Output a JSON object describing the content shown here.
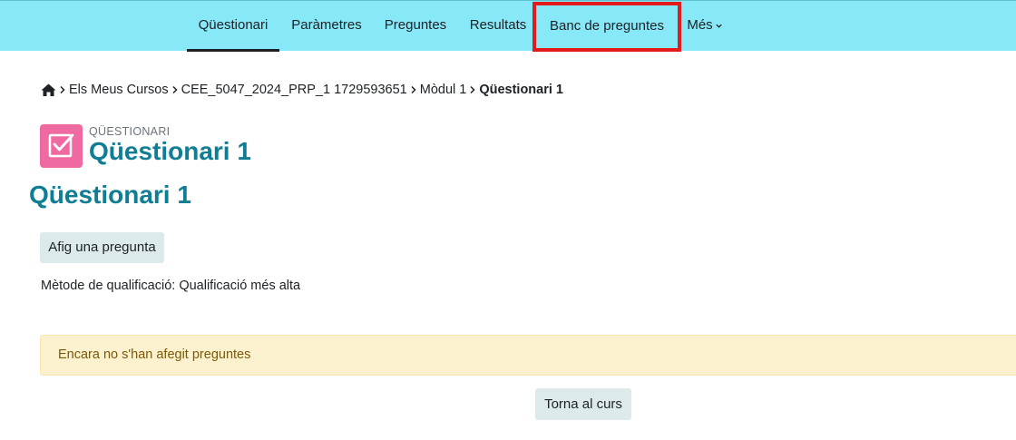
{
  "nav": {
    "items": [
      {
        "label": "Qüestionari"
      },
      {
        "label": "Paràmetres"
      },
      {
        "label": "Preguntes"
      },
      {
        "label": "Resultats"
      },
      {
        "label": "Banc de preguntes"
      },
      {
        "label": "Més"
      }
    ]
  },
  "breadcrumb": {
    "items": [
      "Els Meus Cursos",
      "CEE_5047_2024_PRP_1 1729593651",
      "Mòdul 1",
      "Qüestionari 1"
    ]
  },
  "activity": {
    "type_label": "QÜESTIONARI",
    "title": "Qüestionari 1"
  },
  "page_heading": "Qüestionari 1",
  "add_question_button": "Afig una pregunta",
  "grading": {
    "label": "Mètode de qualificació:",
    "value": "Qualificació més alta"
  },
  "alert_text": "Encara no s'han afegit preguntes",
  "back_button": "Torna al curs",
  "colors": {
    "navbar": "#87e8f7",
    "highlight_border": "#e31b1b",
    "title": "#0f7d93",
    "activity_icon": "#f06aa2",
    "alert_bg": "#fcf1cf"
  }
}
